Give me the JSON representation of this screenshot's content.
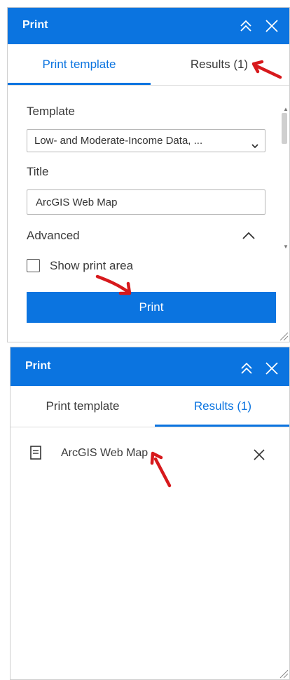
{
  "panel_top": {
    "title": "Print",
    "tabs": {
      "template": "Print template",
      "results": "Results (1)"
    },
    "template_label": "Template",
    "template_value": "Low- and Moderate-Income Data, ...",
    "title_label": "Title",
    "title_value": "ArcGIS Web Map",
    "advanced_label": "Advanced",
    "show_print_area_label": "Show print area",
    "print_button": "Print"
  },
  "panel_bottom": {
    "title": "Print",
    "tabs": {
      "template": "Print template",
      "results": "Results (1)"
    },
    "results": [
      {
        "title": "ArcGIS Web Map"
      }
    ]
  },
  "colors": {
    "accent": "#0b74e0",
    "annotation_arrow": "#d7191c"
  },
  "icons": [
    "collapse-up-icon",
    "close-icon",
    "chevron-down-icon",
    "chevron-up-icon",
    "document-icon",
    "resize-grip-icon",
    "annotation-arrow-icon"
  ]
}
